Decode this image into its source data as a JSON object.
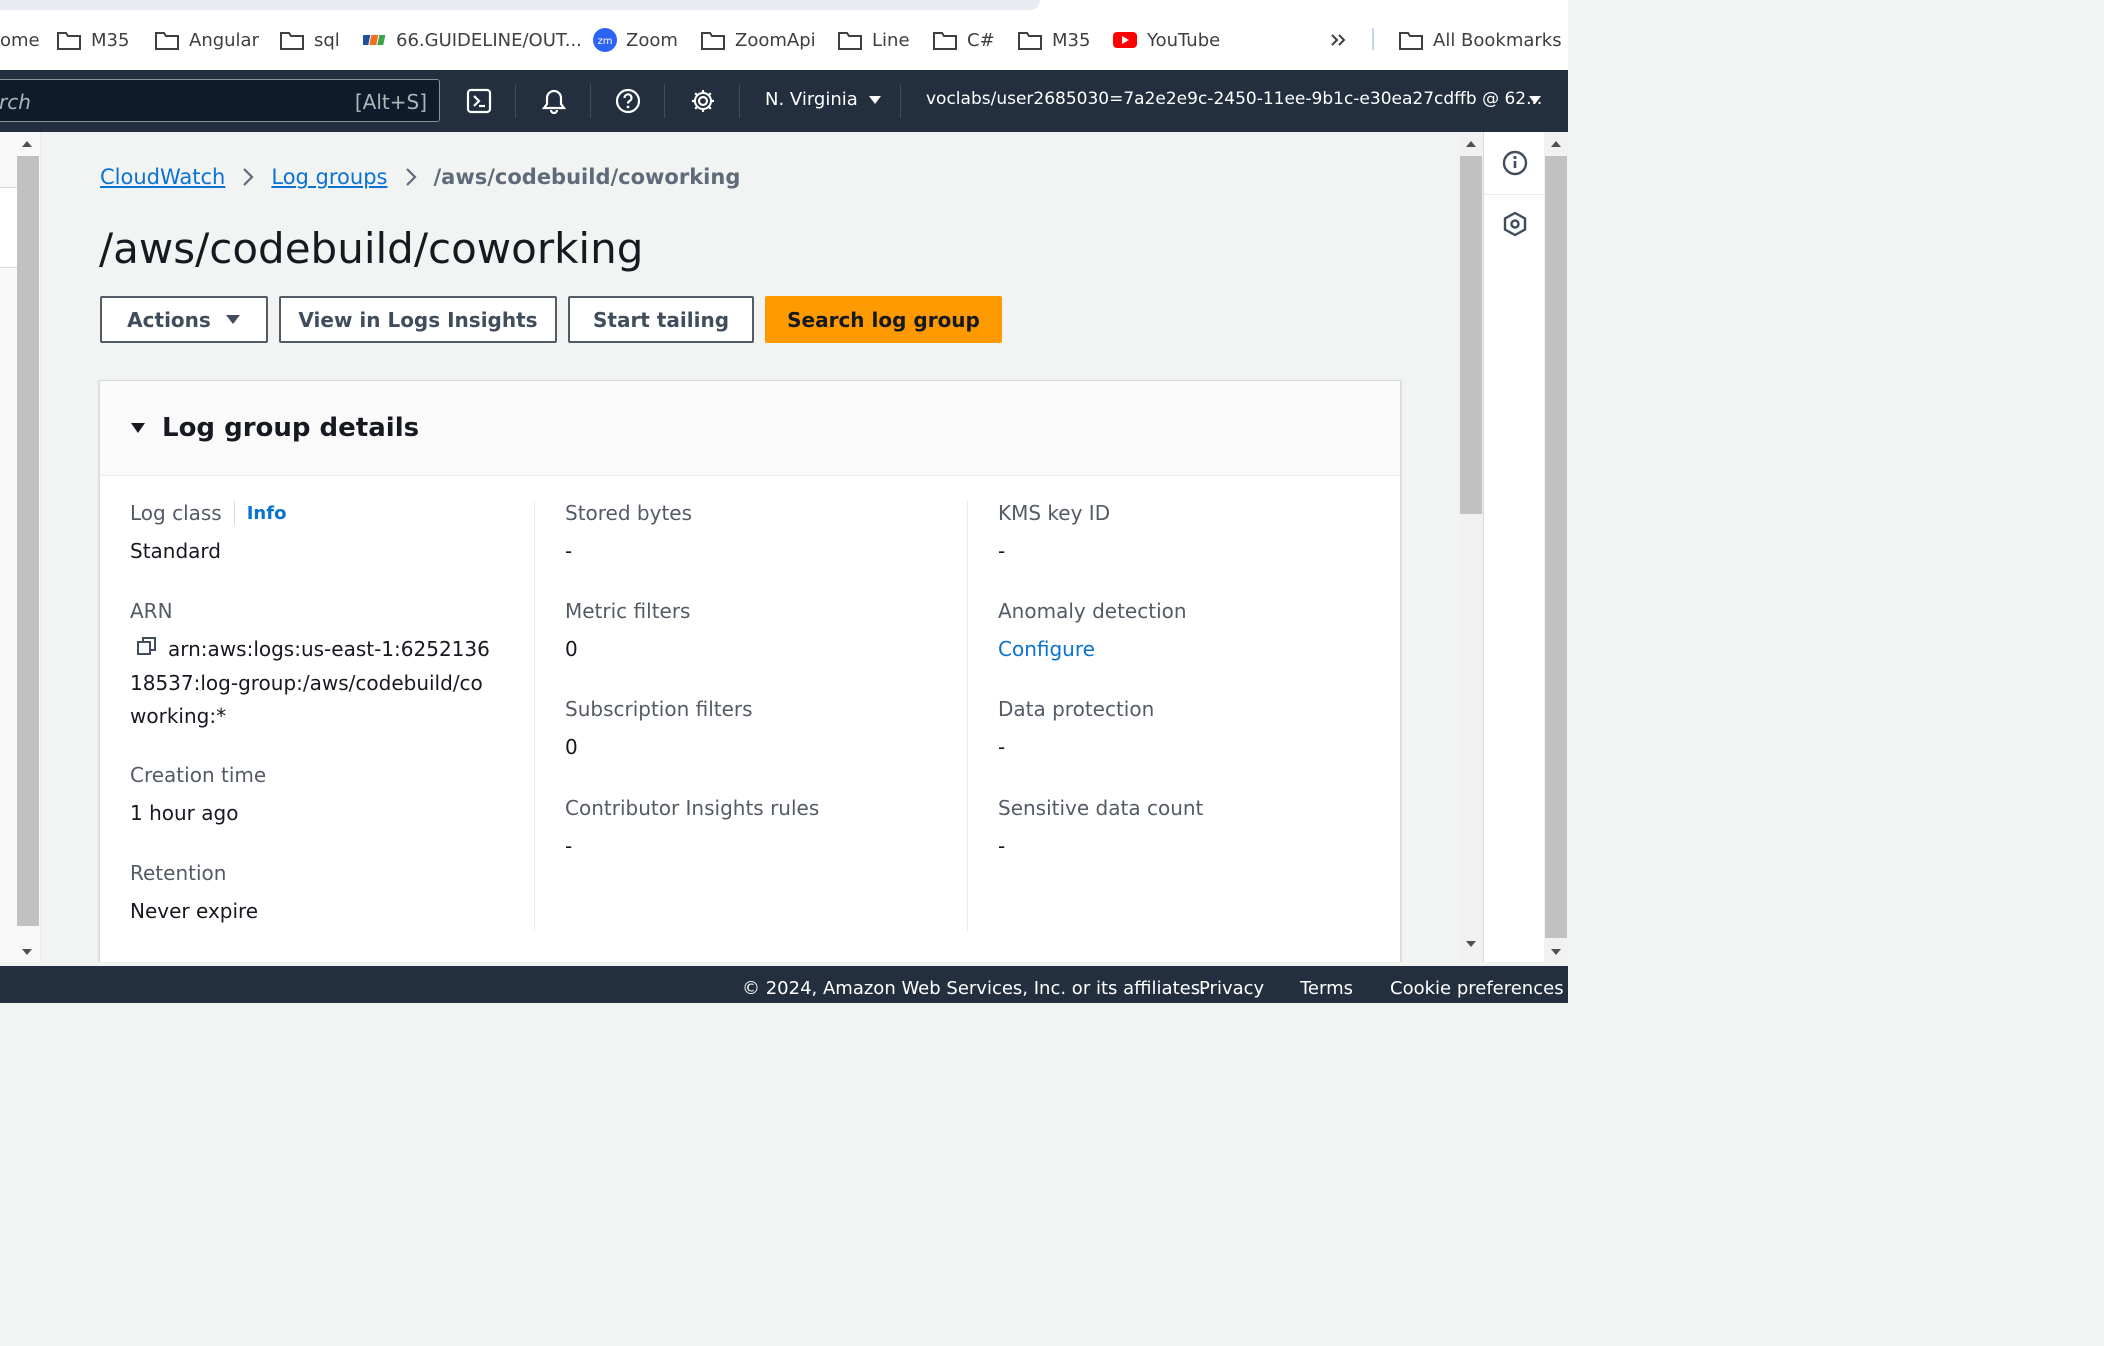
{
  "bookmarks": {
    "items": [
      {
        "label": "ome",
        "icon": "none"
      },
      {
        "label": "M35",
        "icon": "folder-icon"
      },
      {
        "label": "Angular",
        "icon": "folder-icon"
      },
      {
        "label": "sql",
        "icon": "folder-icon"
      },
      {
        "label": "66.GUIDELINE/OUT...",
        "icon": "fpt-logo-icon"
      },
      {
        "label": "Zoom",
        "icon": "zoom-icon"
      },
      {
        "label": "ZoomApi",
        "icon": "folder-icon"
      },
      {
        "label": "Line",
        "icon": "folder-icon"
      },
      {
        "label": "C#",
        "icon": "folder-icon"
      },
      {
        "label": "M35",
        "icon": "folder-icon"
      },
      {
        "label": "YouTube",
        "icon": "youtube-icon"
      }
    ],
    "more_icon": "double-chevron-right-icon",
    "all_bookmarks": "All Bookmarks"
  },
  "topnav": {
    "search_placeholder": "rch",
    "search_shortcut": "[Alt+S]",
    "region": "N. Virginia",
    "account": "voclabs/user2685030=7a2e2e9c-2450-11ee-9b1c-e30ea27cdffb @ 62..."
  },
  "breadcrumb": {
    "items": [
      "CloudWatch",
      "Log groups"
    ],
    "current": "/aws/codebuild/coworking"
  },
  "page": {
    "title": "/aws/codebuild/coworking"
  },
  "actions": {
    "actions_label": "Actions",
    "view_insights_label": "View in Logs Insights",
    "start_tailing_label": "Start tailing",
    "search_label": "Search log group"
  },
  "details": {
    "title": "Log group details",
    "info": "Info",
    "log_class": {
      "label": "Log class",
      "value": "Standard"
    },
    "arn": {
      "label": "ARN",
      "value": "arn:aws:logs:us-east-1:625213618537:log-group:/aws/codebuild/coworking:*"
    },
    "creation_time": {
      "label": "Creation time",
      "value": "1 hour ago"
    },
    "retention": {
      "label": "Retention",
      "value": "Never expire"
    },
    "stored_bytes": {
      "label": "Stored bytes",
      "value": "-"
    },
    "metric_filters": {
      "label": "Metric filters",
      "value": "0"
    },
    "subscription_filters": {
      "label": "Subscription filters",
      "value": "0"
    },
    "contributor_rules": {
      "label": "Contributor Insights rules",
      "value": "-"
    },
    "kms_key": {
      "label": "KMS key ID",
      "value": "-"
    },
    "anomaly": {
      "label": "Anomaly detection",
      "value": "Configure"
    },
    "data_protection": {
      "label": "Data protection",
      "value": "-"
    },
    "sensitive_count": {
      "label": "Sensitive data count",
      "value": "-"
    }
  },
  "footer": {
    "copyright": "© 2024, Amazon Web Services, Inc. or its affiliates.",
    "privacy": "Privacy",
    "terms": "Terms",
    "cookies": "Cookie preferences"
  },
  "colors": {
    "nav_bg": "#232f3e",
    "link": "#0972d3",
    "primary_button": "#ff9900"
  }
}
